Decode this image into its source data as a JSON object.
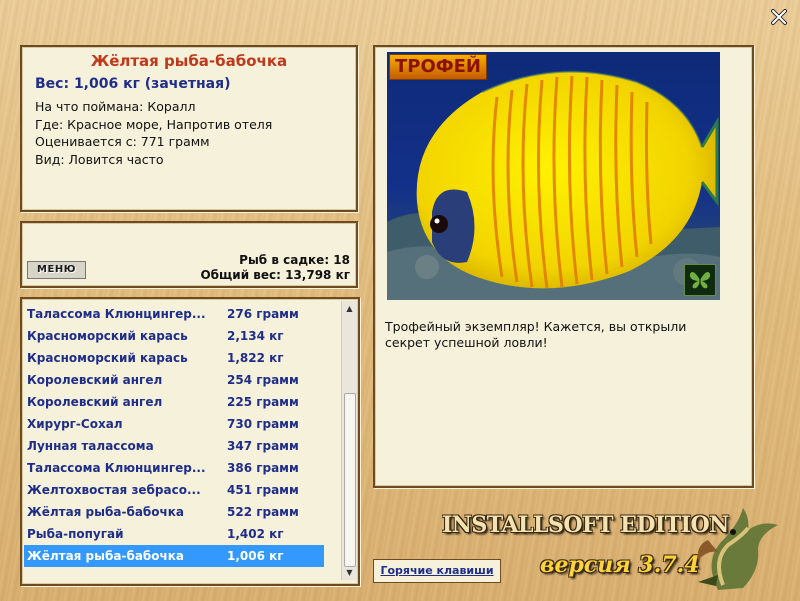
{
  "fish": {
    "title": "Жёлтая рыба-бабочка",
    "weight": "Вес: 1,006 кг (зачетная)",
    "details": [
      "На что поймана: Коралл",
      "Где: Красное море, Напротив отеля",
      "Оценивается с: 771 грамм",
      "Вид: Ловится часто"
    ]
  },
  "menu_label": "МЕНЮ",
  "keep_net": {
    "count_line": "Рыб в садке: 18",
    "total_line": "Общий вес: 13,798 кг"
  },
  "catch_list": [
    {
      "name": "Талассома Клюнцингер...",
      "weight": "276 грамм"
    },
    {
      "name": "Красноморский карась",
      "weight": "2,134 кг"
    },
    {
      "name": "Красноморский карась",
      "weight": "1,822 кг"
    },
    {
      "name": "Королевский ангел",
      "weight": "254 грамм"
    },
    {
      "name": "Королевский ангел",
      "weight": "225 грамм"
    },
    {
      "name": "Хирург-Сохал",
      "weight": "730 грамм"
    },
    {
      "name": "Лунная талассома",
      "weight": "347 грамм"
    },
    {
      "name": "Талассома Клюнцингер...",
      "weight": "386 грамм"
    },
    {
      "name": "Желтохвостая зебрасо...",
      "weight": "451 грамм"
    },
    {
      "name": "Жёлтая рыба-бабочка",
      "weight": "522 грамм"
    },
    {
      "name": "Рыба-попугай",
      "weight": "1,402 кг"
    },
    {
      "name": "Жёлтая рыба-бабочка",
      "weight": "1,006 кг",
      "selected": true
    }
  ],
  "trophy_badge": "ТРОФЕЙ",
  "description": "Трофейный экземпляр! Кажется, вы открыли секрет успешной ловли!",
  "hotkeys_label": "Горячие клавиши",
  "brand": "INSTALLSOFT EDITION",
  "version": "версия 3.7.4",
  "icons": {
    "close": "close-icon",
    "butterfly": "butterfly-icon",
    "pike": "pike-fish-logo",
    "scroll_up": "scroll-up-arrow-icon",
    "scroll_down": "scroll-down-arrow-icon"
  },
  "colors": {
    "title": "#c0391b",
    "weight_text": "#1f2e8a",
    "selection": "#3399ff",
    "fish_yellow": "#f5e000",
    "water_blue": "#13318a"
  }
}
